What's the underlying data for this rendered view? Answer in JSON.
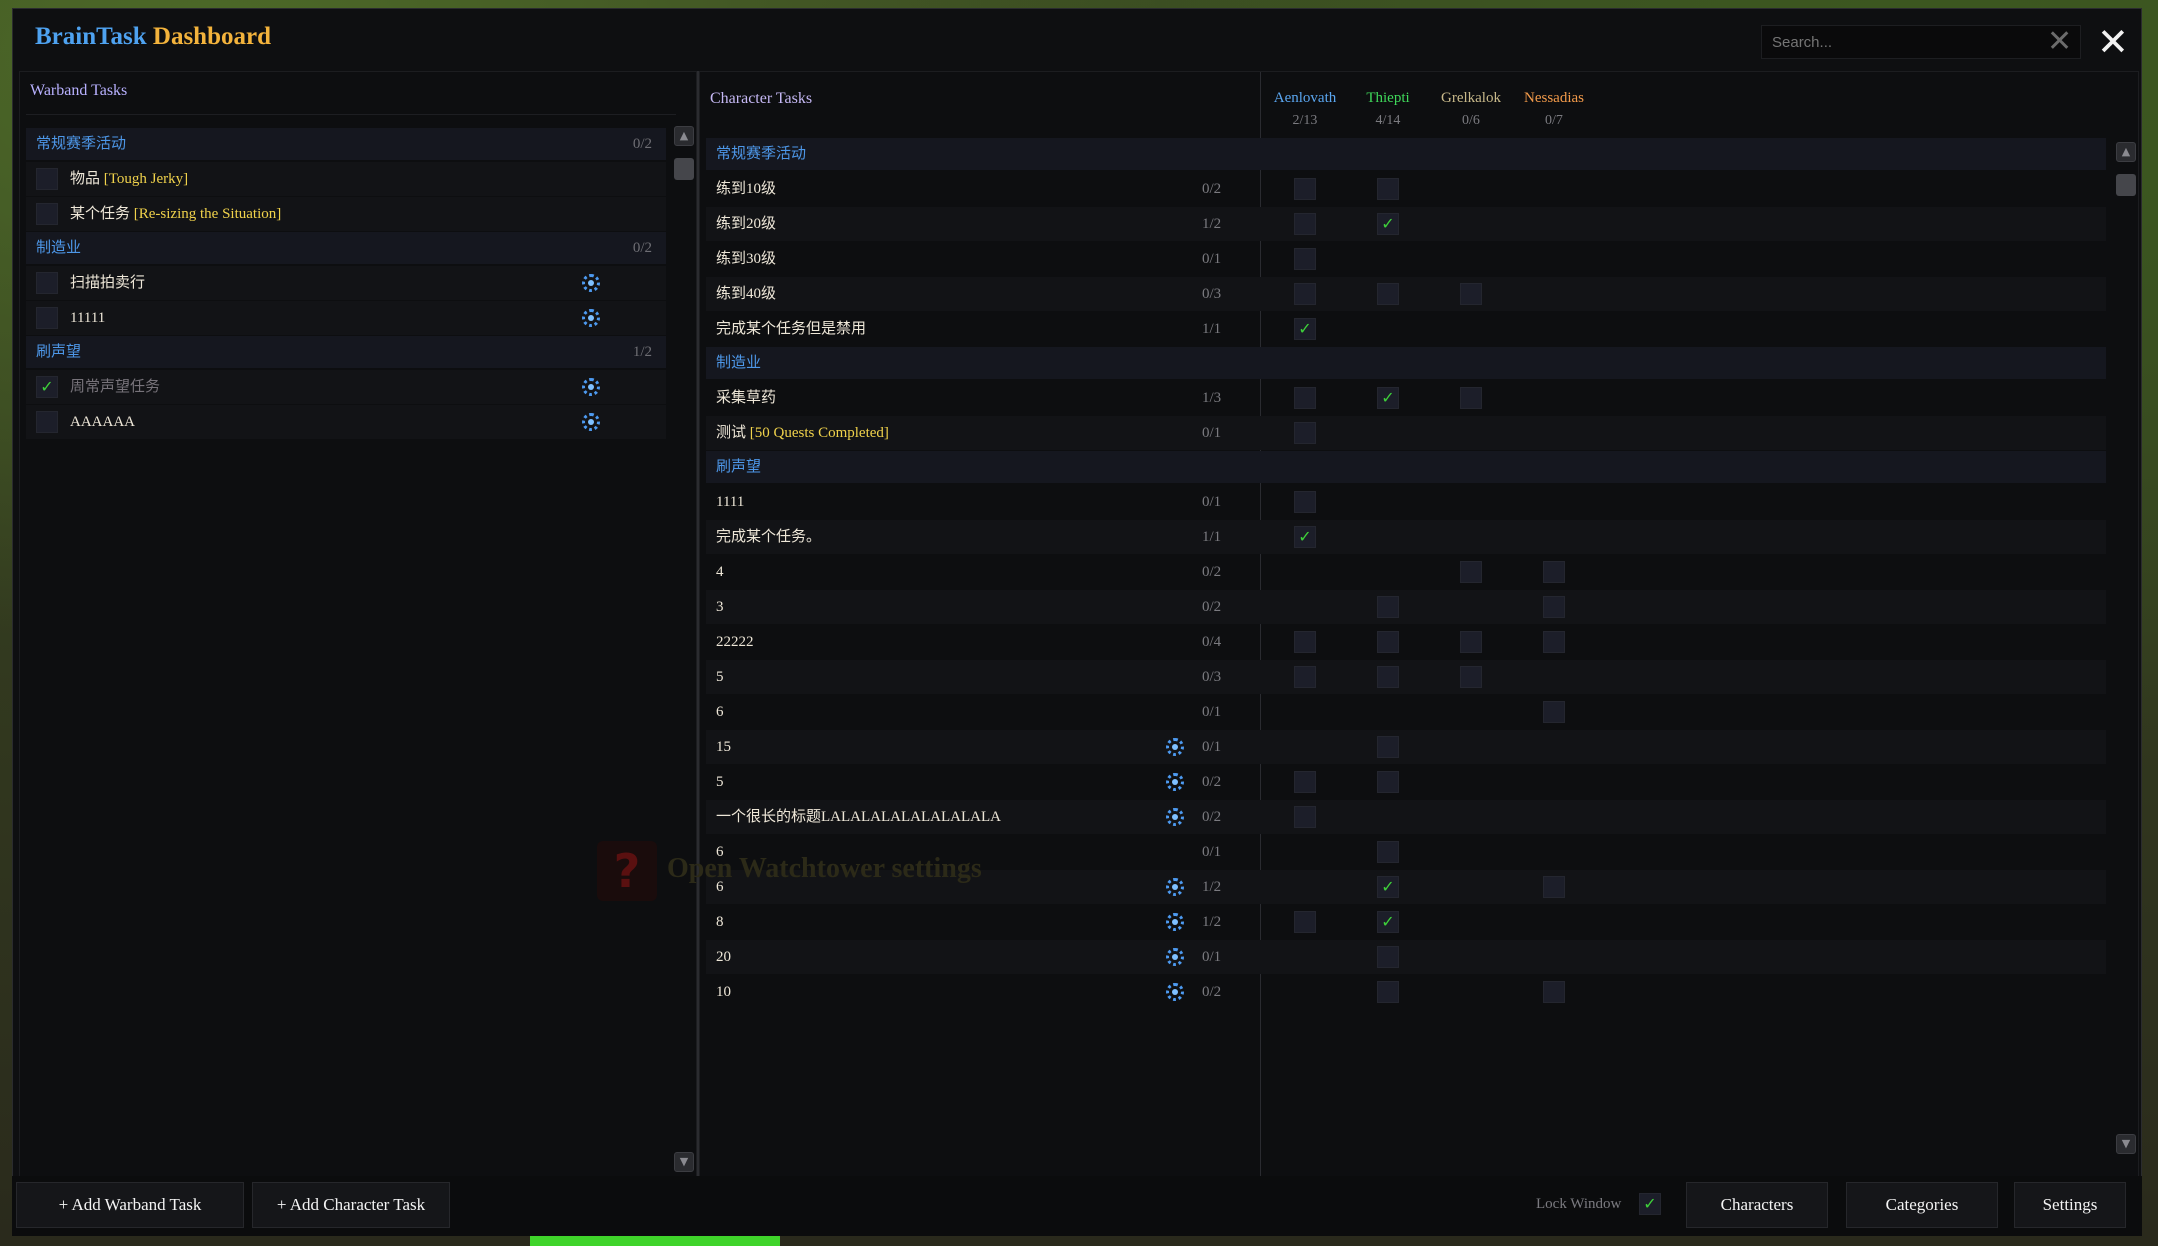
{
  "title": {
    "part1": "BrainTask",
    "part2": "Dashboard"
  },
  "search": {
    "placeholder": "Search..."
  },
  "icons": {
    "search_clear": "✕",
    "close": "✕",
    "check": "✓",
    "scroll_up": "▲",
    "scroll_down": "▼",
    "help": "?"
  },
  "watchtower_hint": "Open Watchtower settings",
  "warband": {
    "header": "Warband Tasks",
    "categories": [
      {
        "label": "常规赛季活动",
        "count": "0/2",
        "tasks": [
          {
            "name": "物品 ",
            "highlight": "[Tough Jerky]",
            "done": false,
            "gear": false
          },
          {
            "name": "某个任务 ",
            "highlight": "[Re-sizing the Situation]",
            "done": false,
            "gear": false
          }
        ]
      },
      {
        "label": "制造业",
        "count": "0/2",
        "tasks": [
          {
            "name": "扫描拍卖行",
            "highlight": "",
            "done": false,
            "gear": true
          },
          {
            "name": "11111",
            "highlight": "",
            "done": false,
            "gear": true
          }
        ]
      },
      {
        "label": "刷声望",
        "count": "1/2",
        "tasks": [
          {
            "name": "周常声望任务",
            "highlight": "",
            "done": true,
            "gear": true
          },
          {
            "name": "AAAAAA",
            "highlight": "",
            "done": false,
            "gear": true
          }
        ]
      }
    ]
  },
  "character": {
    "header": "Character Tasks",
    "characters": [
      {
        "name": "Aenlovath",
        "summary": "2/13",
        "color": "#5aa6f0"
      },
      {
        "name": "Thiepti",
        "summary": "4/14",
        "color": "#3fd85a"
      },
      {
        "name": "Grelkalok",
        "summary": "0/6",
        "color": "#c8b98a"
      },
      {
        "name": "Nessadias",
        "summary": "0/7",
        "color": "#f29a4a"
      }
    ],
    "categories": [
      {
        "label": "常规赛季活动",
        "tasks": [
          {
            "name": "练到10级",
            "highlight": "",
            "count": "0/2",
            "gear": false,
            "cells": [
              "box",
              "box",
              "",
              ""
            ]
          },
          {
            "name": "练到20级",
            "highlight": "",
            "count": "1/2",
            "gear": false,
            "cells": [
              "box",
              "check",
              "",
              ""
            ]
          },
          {
            "name": "练到30级",
            "highlight": "",
            "count": "0/1",
            "gear": false,
            "cells": [
              "box",
              "",
              "",
              ""
            ]
          },
          {
            "name": "练到40级",
            "highlight": "",
            "count": "0/3",
            "gear": false,
            "cells": [
              "box",
              "box",
              "box",
              ""
            ]
          },
          {
            "name": "完成某个任务但是禁用",
            "highlight": "",
            "count": "1/1",
            "gear": false,
            "cells": [
              "check",
              "",
              "",
              ""
            ]
          }
        ]
      },
      {
        "label": "制造业",
        "tasks": [
          {
            "name": "采集草药",
            "highlight": "",
            "count": "1/3",
            "gear": false,
            "cells": [
              "box",
              "check",
              "box",
              ""
            ]
          },
          {
            "name": "测试 ",
            "highlight": "[50 Quests Completed]",
            "count": "0/1",
            "gear": false,
            "cells": [
              "box",
              "",
              "",
              ""
            ]
          }
        ]
      },
      {
        "label": "刷声望",
        "tasks": [
          {
            "name": "1111",
            "highlight": "",
            "count": "0/1",
            "gear": false,
            "cells": [
              "box",
              "",
              "",
              ""
            ]
          },
          {
            "name": "完成某个任务。",
            "highlight": "",
            "count": "1/1",
            "gear": false,
            "cells": [
              "check",
              "",
              "",
              ""
            ]
          },
          {
            "name": "4",
            "highlight": "",
            "count": "0/2",
            "gear": false,
            "cells": [
              "",
              "",
              "box",
              "box"
            ]
          },
          {
            "name": "3",
            "highlight": "",
            "count": "0/2",
            "gear": false,
            "cells": [
              "",
              "box",
              "",
              "box"
            ]
          },
          {
            "name": "22222",
            "highlight": "",
            "count": "0/4",
            "gear": false,
            "cells": [
              "box",
              "box",
              "box",
              "box"
            ]
          },
          {
            "name": "5",
            "highlight": "",
            "count": "0/3",
            "gear": false,
            "cells": [
              "box",
              "box",
              "box",
              ""
            ]
          },
          {
            "name": "6",
            "highlight": "",
            "count": "0/1",
            "gear": false,
            "cells": [
              "",
              "",
              "",
              "box"
            ]
          },
          {
            "name": "15",
            "highlight": "",
            "count": "0/1",
            "gear": true,
            "cells": [
              "",
              "box",
              "",
              ""
            ]
          },
          {
            "name": "5",
            "highlight": "",
            "count": "0/2",
            "gear": true,
            "cells": [
              "box",
              "box",
              "",
              ""
            ]
          },
          {
            "name": "一个很长的标题LALALALALALALALALA",
            "highlight": "",
            "count": "0/2",
            "gear": true,
            "cells": [
              "box",
              "",
              "",
              ""
            ]
          },
          {
            "name": "6",
            "highlight": "",
            "count": "0/1",
            "gear": false,
            "cells": [
              "",
              "box",
              "",
              ""
            ]
          },
          {
            "name": "6",
            "highlight": "",
            "count": "1/2",
            "gear": true,
            "cells": [
              "",
              "check",
              "",
              "box"
            ]
          },
          {
            "name": "8",
            "highlight": "",
            "count": "1/2",
            "gear": true,
            "cells": [
              "box",
              "check",
              "",
              ""
            ]
          },
          {
            "name": "20",
            "highlight": "",
            "count": "0/1",
            "gear": true,
            "cells": [
              "",
              "box",
              "",
              ""
            ]
          },
          {
            "name": "10",
            "highlight": "",
            "count": "0/2",
            "gear": true,
            "cells": [
              "",
              "box",
              "",
              "box"
            ]
          }
        ]
      }
    ]
  },
  "footer": {
    "add_warband": "+ Add Warband Task",
    "add_character": "+ Add Character Task",
    "lock_window": "Lock Window",
    "lock_checked": true,
    "characters_btn": "Characters",
    "categories_btn": "Categories",
    "settings_btn": "Settings"
  }
}
